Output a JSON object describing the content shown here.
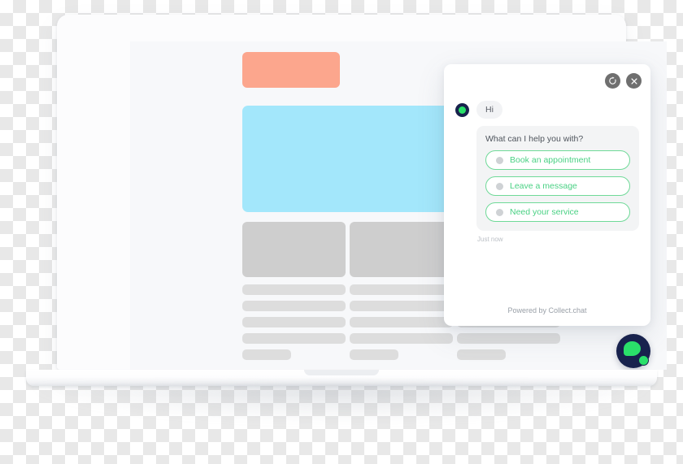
{
  "device": {
    "type": "laptop-mockup",
    "frame_color": "#fcfcfd",
    "screen_bg": "#f7f8fa"
  },
  "website": {
    "header_chip_color": "#fca68d",
    "hero_color": "#a3e7fb",
    "placeholder_block_color": "#cecece",
    "placeholder_line_color": "#dddddd",
    "columns": [
      {
        "lines": [
          127,
          127,
          127,
          127,
          60
        ]
      },
      {
        "lines": [
          127,
          127,
          127,
          127,
          60
        ]
      },
      {
        "lines": [
          127,
          127,
          60
        ]
      }
    ]
  },
  "chat_widget": {
    "controls": [
      {
        "name": "refresh",
        "icon": "refresh-icon",
        "label": "Restart chat"
      },
      {
        "name": "close",
        "icon": "close-icon",
        "label": "Close chat"
      }
    ],
    "messages": [
      {
        "type": "greeting",
        "avatar": "bot-avatar",
        "text": "Hi"
      },
      {
        "type": "question",
        "text": "What can I help you with?",
        "options": [
          "Book an appointment",
          "Leave a message",
          "Need your service"
        ]
      }
    ],
    "timestamp": "Just now",
    "footer": "Powered by Collect.chat",
    "colors": {
      "option_border": "#6fd998",
      "option_text": "#4ad184",
      "avatar_bg": "#18224d",
      "avatar_dot": "#2ae06a",
      "bubble_bg": "#f2f3f5",
      "group_bg": "#f3f4f5",
      "control_bg": "#6f6f6f"
    }
  },
  "launcher": {
    "name": "chat-launcher",
    "bg": "#18224d",
    "bubble_color": "#2ae06a",
    "badge_color": "#2ae06a"
  }
}
